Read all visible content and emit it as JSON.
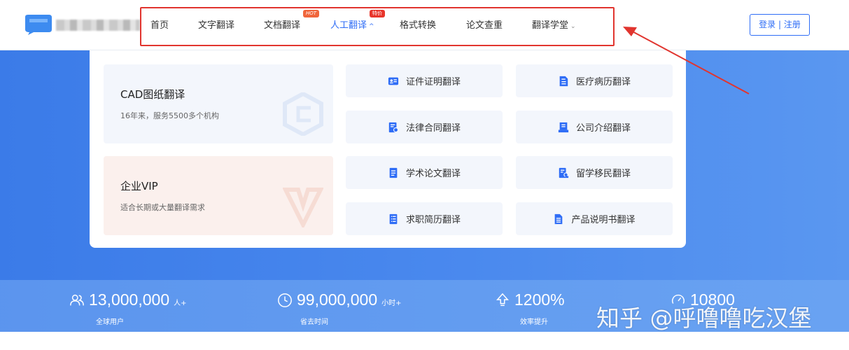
{
  "nav": {
    "items": [
      {
        "label": "首页"
      },
      {
        "label": "文字翻译"
      },
      {
        "label": "文档翻译",
        "badge": "HOT"
      },
      {
        "label": "人工翻译",
        "badge": "特价",
        "caret": "^",
        "active": true
      },
      {
        "label": "格式转换"
      },
      {
        "label": "论文查重"
      },
      {
        "label": "翻译学堂",
        "caret": "⌄"
      }
    ]
  },
  "login_label": "登录 | 注册",
  "dropdown": {
    "cad": {
      "title": "CAD图纸翻译",
      "subtitle": "16年来，服务5500多个机构"
    },
    "vip": {
      "title": "企业VIP",
      "subtitle": "适合长期或大量翻译需求"
    },
    "services": [
      {
        "label": "证件证明翻译",
        "icon": "id-card-icon"
      },
      {
        "label": "医疗病历翻译",
        "icon": "medical-record-icon"
      },
      {
        "label": "法律合同翻译",
        "icon": "contract-icon"
      },
      {
        "label": "公司介绍翻译",
        "icon": "company-icon"
      },
      {
        "label": "学术论文翻译",
        "icon": "paper-icon"
      },
      {
        "label": "留学移民翻译",
        "icon": "immigration-icon"
      },
      {
        "label": "求职简历翻译",
        "icon": "resume-icon"
      },
      {
        "label": "产品说明书翻译",
        "icon": "manual-icon"
      }
    ]
  },
  "stats": [
    {
      "number": "13,000,000",
      "unit": "人+",
      "label": "全球用户",
      "icon": "users-icon"
    },
    {
      "number": "99,000,000",
      "unit": "小时+",
      "label": "省去时间",
      "icon": "clock-icon"
    },
    {
      "number": "1200%",
      "unit": "",
      "label": "效率提升",
      "icon": "arrow-up-icon"
    },
    {
      "number": "10800",
      "unit": "",
      "label": "",
      "icon": "speed-icon"
    }
  ],
  "watermark_text": "知乎 @呼噜噜吃汉堡",
  "colors": {
    "accent": "#2f6df6",
    "annotation": "#e1352f",
    "hero": "#3b7be8"
  }
}
